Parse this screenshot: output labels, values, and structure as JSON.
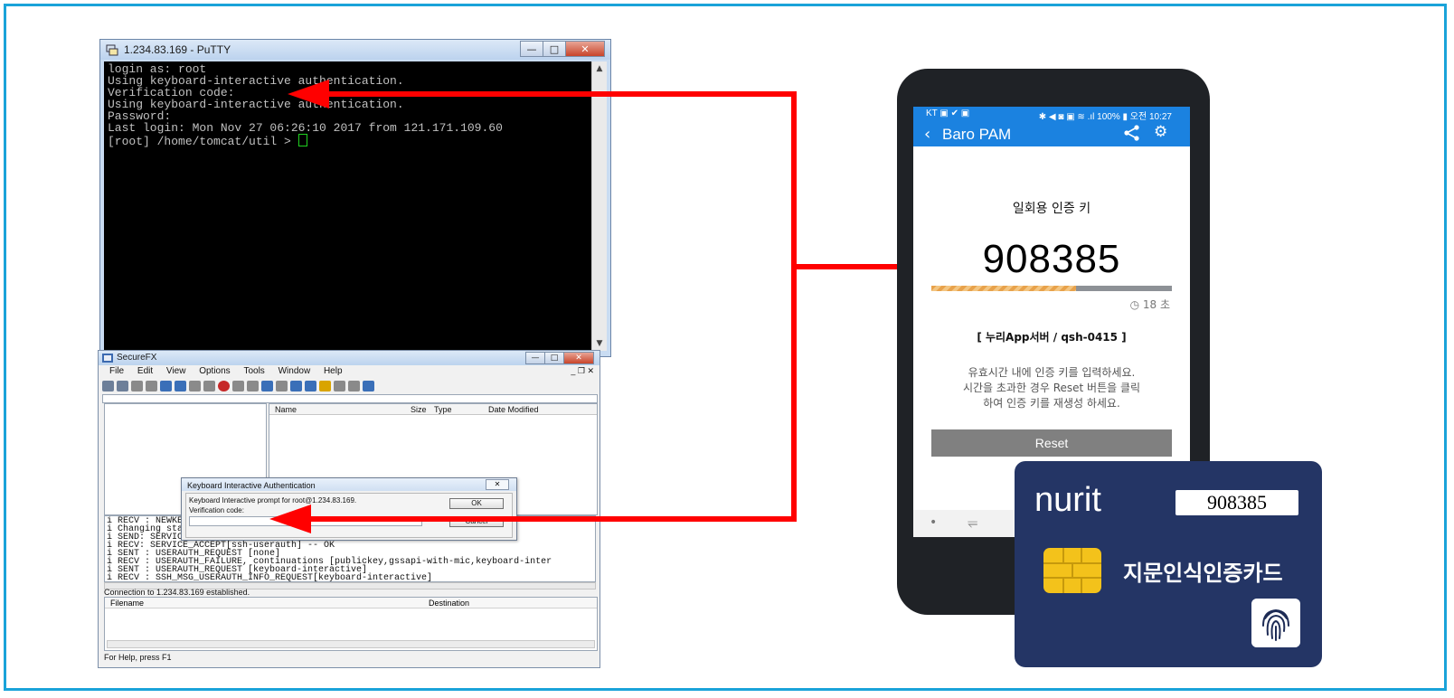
{
  "putty": {
    "title": "1.234.83.169 - PuTTY",
    "lines": [
      "login as: root",
      "Using keyboard-interactive authentication.",
      "Verification code:",
      "Using keyboard-interactive authentication.",
      "Password:",
      "Last login: Mon Nov 27 06:26:10 2017 from 121.171.109.60",
      "[root] /home/tomcat/util > "
    ],
    "buttons": {
      "minimize": "—",
      "maximize": "□",
      "close": "✕"
    }
  },
  "securefx": {
    "title": "SecureFX",
    "menu": [
      "File",
      "Edit",
      "View",
      "Options",
      "Tools",
      "Window",
      "Help"
    ],
    "mdi_controls": "_ ❐ ✕",
    "file_columns": [
      "Name",
      "Size",
      "Type",
      "Date Modified"
    ],
    "log_lines": [
      "i RECV : NEWKE",
      "i Changing sta",
      "i SEND: SERVIC",
      "i RECV: SERVICE_ACCEPT[ssh-userauth] -- OK",
      "i SENT : USERAUTH_REQUEST [none]",
      "i RECV : USERAUTH_FAILURE, continuations [publickey,gssapi-with-mic,keyboard-inter",
      "i SENT : USERAUTH_REQUEST [keyboard-interactive]",
      "i RECV : SSH_MSG_USERAUTH_INFO_REQUEST[keyboard-interactive]"
    ],
    "status": "Connection to 1.234.83.169 established.",
    "transfer_columns": [
      "Filename",
      "Destination"
    ],
    "help": "For Help, press F1"
  },
  "dialog": {
    "title": "Keyboard Interactive Authentication",
    "prompt": "Keyboard Interactive prompt for root@1.234.83.169.",
    "label": "Verification code:",
    "ok": "OK",
    "cancel": "Cancel",
    "close": "✕"
  },
  "arrows": {
    "color": "#ff0000"
  },
  "phone": {
    "status_left": "KT ▣ ✔ ▣",
    "status_right": "✱ ◀ ◙ ▣ ≋ .ıl 100% ▮ 오전 10:27",
    "app_title": "Baro PAM",
    "back": "‹",
    "gear": "⚙",
    "otp_label": "일회용 인증 키",
    "otp_code": "908385",
    "progress_fraction": 0.6,
    "timer": "◷ 18 초",
    "server": "[ 누리App서버 / qsh-0415 ]",
    "desc": [
      "유효시간 내에 인증 키를 입력하세요.",
      "시간을 초과한 경우 Reset 버튼을 클릭",
      "하여 인증 키를 재생성 하세요."
    ],
    "reset": "Reset",
    "nav": [
      "•",
      "⥫"
    ],
    "accent": "#1b82e0"
  },
  "card": {
    "brand": "nurit",
    "code": "908385",
    "title": "지문인식인증카드",
    "color": "#243565"
  }
}
